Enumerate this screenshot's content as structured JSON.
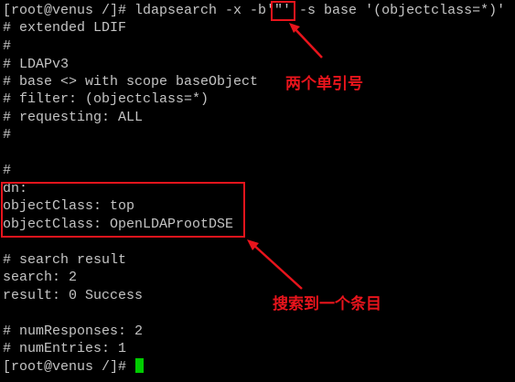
{
  "colors": {
    "text": "#c4c4c4",
    "cursor": "#00cc00",
    "annotation": "#e8141c"
  },
  "terminal": {
    "lines": [
      "[root@venus /]# ldapsearch -x -b'\"' -s base '(objectclass=*)'",
      "# extended LDIF",
      "#",
      "# LDAPv3",
      "# base <> with scope baseObject",
      "# filter: (objectclass=*)",
      "# requesting: ALL",
      "#",
      "",
      "#",
      "dn:",
      "objectClass: top",
      "objectClass: OpenLDAProotDSE",
      "",
      "# search result",
      "search: 2",
      "result: 0 Success",
      "",
      "# numResponses: 2",
      "# numEntries: 1",
      "[root@venus /]# "
    ]
  },
  "annotations": {
    "quotes_note": "两个单引号",
    "entry_note": "搜索到一个条目"
  }
}
